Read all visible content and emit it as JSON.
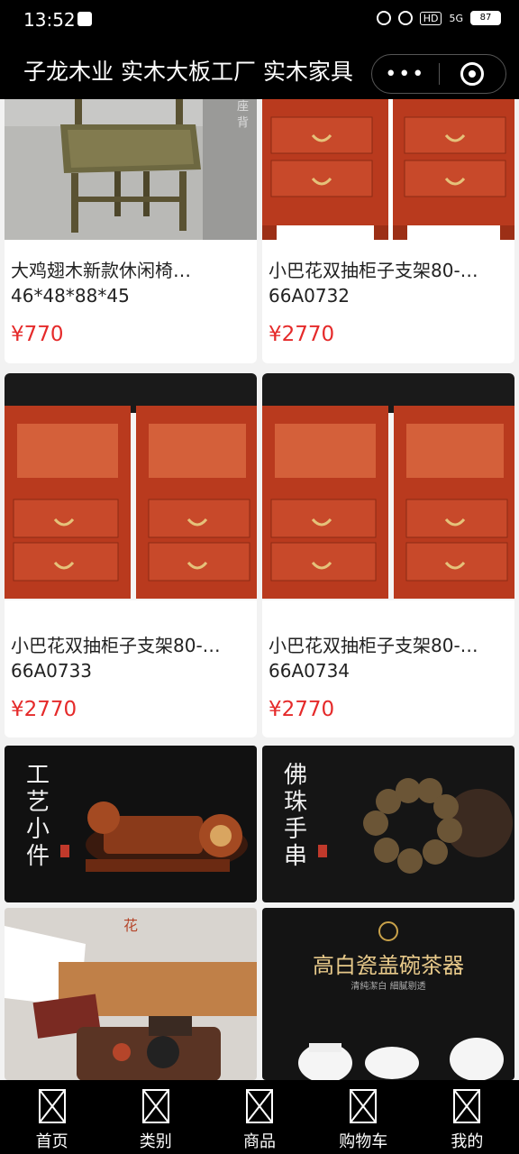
{
  "status_bar": {
    "time": "13:52",
    "battery": "87",
    "network_hd": "HD",
    "network_type": "5G"
  },
  "header": {
    "title": "子龙木业 实木大板工厂 实木家具",
    "more_label": "•••"
  },
  "products": [
    {
      "name": "大鸡翅木新款休闲椅…",
      "code": "46*48*88*45",
      "price": "¥770"
    },
    {
      "name": "小巴花双抽柜子支架80-…",
      "code": "66A0732",
      "price": "¥2770"
    },
    {
      "name": "小巴花双抽柜子支架80-…",
      "code": "66A0733",
      "price": "¥2770"
    },
    {
      "name": "小巴花双抽柜子支架80-…",
      "code": "66A0734",
      "price": "¥2770"
    }
  ],
  "banners": [
    {
      "text": "工艺小件"
    },
    {
      "text": "佛珠手串"
    },
    {
      "text": "花"
    },
    {
      "text": "高白瓷盖碗茶器",
      "sub": "清純潔白 細膩剔透"
    }
  ],
  "tabbar": [
    {
      "label": "首页",
      "icon": "home-icon",
      "active": true
    },
    {
      "label": "类别",
      "icon": "category-icon",
      "active": false
    },
    {
      "label": "商品",
      "icon": "goods-icon",
      "active": false
    },
    {
      "label": "购物车",
      "icon": "cart-icon",
      "active": false
    },
    {
      "label": "我的",
      "icon": "profile-icon",
      "active": false
    }
  ],
  "colors": {
    "price": "#e52a2a",
    "bar_bg": "#000000",
    "page_bg": "#f2f2f2"
  }
}
